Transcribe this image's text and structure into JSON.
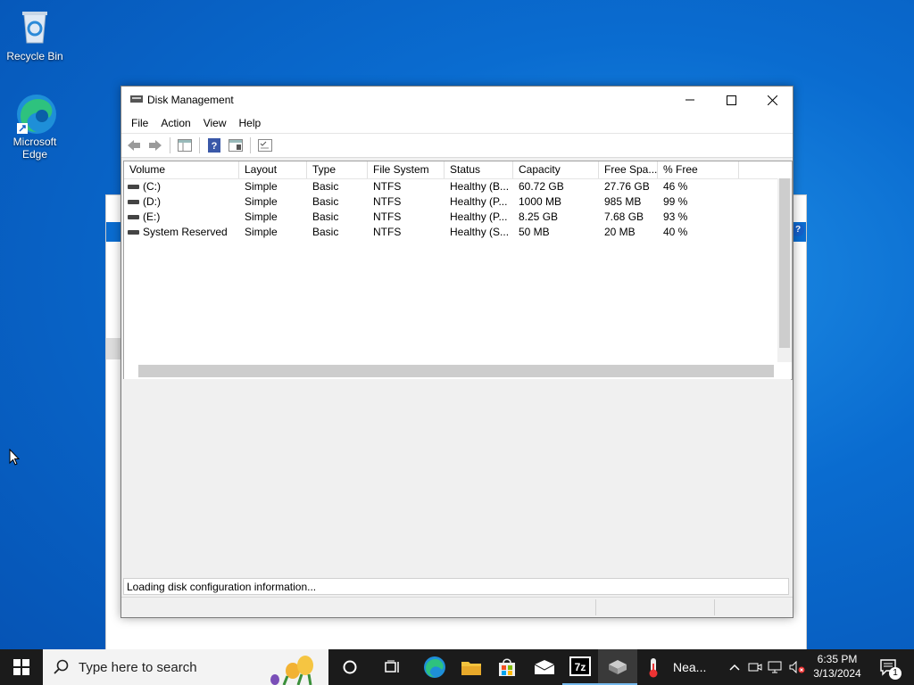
{
  "desktop": {
    "icons": [
      {
        "label": "Recycle Bin",
        "icon": "recycle-bin-icon"
      },
      {
        "label_line1": "Microsoft",
        "label_line2": "Edge",
        "icon": "edge-icon"
      }
    ]
  },
  "window": {
    "title": "Disk Management",
    "menu": [
      "File",
      "Action",
      "View",
      "Help"
    ],
    "toolbar_icons": [
      "back-arrow-icon",
      "forward-arrow-icon",
      "show-hide-console-tree-icon",
      "help-icon",
      "properties-icon",
      "console-icon"
    ],
    "columns": [
      "Volume",
      "Layout",
      "Type",
      "File System",
      "Status",
      "Capacity",
      "Free Spa...",
      "% Free"
    ],
    "rows": [
      {
        "volume": "(C:)",
        "layout": "Simple",
        "type": "Basic",
        "fs": "NTFS",
        "status": "Healthy (B...",
        "capacity": "60.72 GB",
        "free": "27.76 GB",
        "pct": "46 %"
      },
      {
        "volume": "(D:)",
        "layout": "Simple",
        "type": "Basic",
        "fs": "NTFS",
        "status": "Healthy (P...",
        "capacity": "1000 MB",
        "free": "985 MB",
        "pct": "99 %"
      },
      {
        "volume": "(E:)",
        "layout": "Simple",
        "type": "Basic",
        "fs": "NTFS",
        "status": "Healthy (P...",
        "capacity": "8.25 GB",
        "free": "7.68 GB",
        "pct": "93 %"
      },
      {
        "volume": "System Reserved",
        "layout": "Simple",
        "type": "Basic",
        "fs": "NTFS",
        "status": "Healthy (S...",
        "capacity": "50 MB",
        "free": "20 MB",
        "pct": "40 %"
      }
    ],
    "status_text": "Loading disk configuration information..."
  },
  "taskbar": {
    "search_placeholder": "Type here to search",
    "weather_label": "Nea...",
    "time": "6:35 PM",
    "date": "3/13/2024",
    "notification_count": "1",
    "colors": {
      "background": "#1b1b1b",
      "accent": "#0a6cd0"
    }
  }
}
